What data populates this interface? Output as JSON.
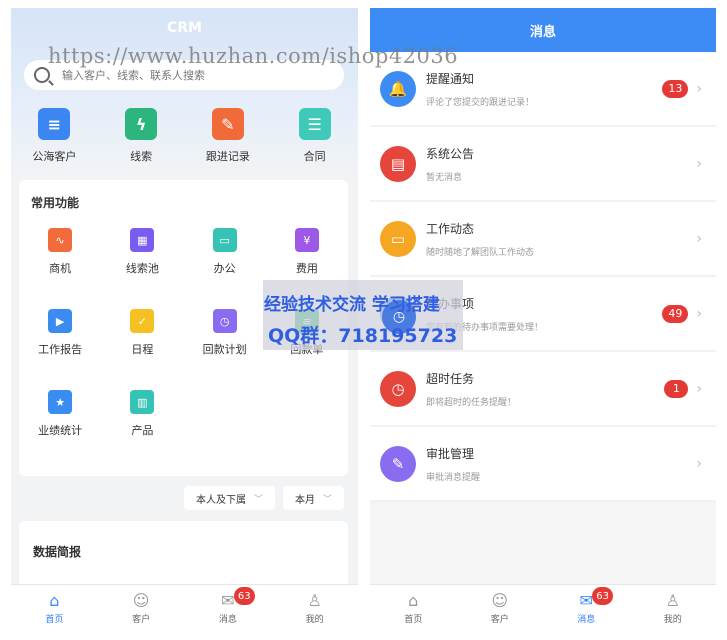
{
  "left": {
    "title": "CRM",
    "search_placeholder": "输入客户、线索、联系人搜索",
    "quick": [
      {
        "label": "公海客户",
        "icon": "customer-pool-icon",
        "color": "#3b86f0",
        "glyph": "≡"
      },
      {
        "label": "线索",
        "icon": "lead-icon",
        "color": "#2cb67d",
        "glyph": "ϟ"
      },
      {
        "label": "跟进记录",
        "icon": "followup-record-icon",
        "color": "#f06a3a",
        "glyph": "✎"
      },
      {
        "label": "合同",
        "icon": "contract-icon",
        "color": "#3ec9b8",
        "glyph": "☰"
      }
    ],
    "functions_title": "常用功能",
    "functions": [
      {
        "label": "商机",
        "icon": "business-opportunity-icon",
        "color": "#f26b3a",
        "glyph": "∿"
      },
      {
        "label": "线索池",
        "icon": "lead-pool-icon",
        "color": "#7a5cf0",
        "glyph": "▦"
      },
      {
        "label": "办公",
        "icon": "office-icon",
        "color": "#36c2b4",
        "glyph": "▭"
      },
      {
        "label": "费用",
        "icon": "expense-icon",
        "color": "#9b59e6",
        "glyph": "¥"
      },
      {
        "label": "工作报告",
        "icon": "work-report-icon",
        "color": "#3a8cf0",
        "glyph": "▶"
      },
      {
        "label": "日程",
        "icon": "schedule-icon",
        "color": "#f5c021",
        "glyph": "✓"
      },
      {
        "label": "回款计划",
        "icon": "payment-plan-icon",
        "color": "#8a6cf0",
        "glyph": "◷"
      },
      {
        "label": "回款单",
        "icon": "payment-receipt-icon",
        "color": "#2cb67d",
        "glyph": "≡"
      },
      {
        "label": "业绩统计",
        "icon": "performance-stats-icon",
        "color": "#3a8cf0",
        "glyph": "★"
      },
      {
        "label": "产品",
        "icon": "product-icon",
        "color": "#36c2b4",
        "glyph": "▥"
      }
    ],
    "filters": [
      {
        "label": "本人及下属"
      },
      {
        "label": "本月"
      }
    ],
    "report_title": "数据简报",
    "tabs": [
      {
        "label": "首页",
        "icon": "home-icon",
        "glyph": "⌂",
        "active": true
      },
      {
        "label": "客户",
        "icon": "customer-icon",
        "glyph": "☺",
        "active": false
      },
      {
        "label": "消息",
        "icon": "message-icon",
        "glyph": "✉",
        "active": false,
        "badge": "63"
      },
      {
        "label": "我的",
        "icon": "profile-icon",
        "glyph": "♙",
        "active": false
      }
    ]
  },
  "right": {
    "title": "消息",
    "messages": [
      {
        "title": "提醒通知",
        "desc": "评论了您提交的跟进记录！",
        "badge": "13",
        "icon": "bell-icon",
        "color": "#3d8bf5",
        "glyph": "🔔"
      },
      {
        "title": "系统公告",
        "desc": "暂无消息",
        "badge": "",
        "icon": "announcement-icon",
        "color": "#e5453a",
        "glyph": "▤"
      },
      {
        "title": "工作动态",
        "desc": "随时随地了解团队工作动态",
        "badge": "",
        "icon": "work-feed-icon",
        "color": "#f5a623",
        "glyph": "▭"
      },
      {
        "title": "待办事项",
        "desc": "您有新的待办事项需要处理！",
        "badge": "49",
        "icon": "todo-icon",
        "color": "#3d8bf5",
        "glyph": "◷"
      },
      {
        "title": "超时任务",
        "desc": "即将超时的任务提醒！",
        "badge": "1",
        "icon": "overdue-task-icon",
        "color": "#e5453a",
        "glyph": "◷"
      },
      {
        "title": "审批管理",
        "desc": "审批消息提醒",
        "badge": "",
        "icon": "approval-icon",
        "color": "#8a6cf0",
        "glyph": "✎"
      }
    ],
    "tabs": [
      {
        "label": "首页",
        "icon": "home-icon",
        "glyph": "⌂",
        "active": false
      },
      {
        "label": "客户",
        "icon": "customer-icon",
        "glyph": "☺",
        "active": false
      },
      {
        "label": "消息",
        "icon": "message-icon",
        "glyph": "✉",
        "active": true,
        "badge": "63"
      },
      {
        "label": "我的",
        "icon": "profile-icon",
        "glyph": "♙",
        "active": false
      }
    ]
  },
  "watermark": {
    "url": "https://www.huzhan.com/ishop42036",
    "line1": "经验技术交流 学习搭建",
    "line2": "QQ群：718195723"
  },
  "colors": {
    "accent": "#3d8bf5",
    "badge": "#e53935"
  }
}
